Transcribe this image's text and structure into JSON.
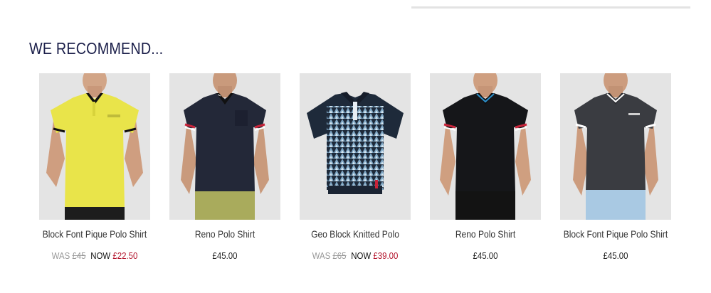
{
  "section": {
    "title": "WE RECOMMEND..."
  },
  "products": [
    {
      "name": "Block Font Pique Polo Shirt",
      "was_label": "WAS",
      "was_price": "£45",
      "now_label": "NOW",
      "now_price": "£22.50",
      "image": "yellow-polo-shirt-model",
      "shirt_color": "#e9e44a"
    },
    {
      "name": "Reno Polo Shirt",
      "price": "£45.00",
      "image": "navy-polo-shirt-model",
      "shirt_color": "#232838"
    },
    {
      "name": "Geo Block Knitted Polo",
      "was_label": "WAS",
      "was_price": "£65",
      "now_label": "NOW",
      "now_price": "£39.00",
      "image": "geo-knitted-polo-flat",
      "shirt_color": "#1e2a3a"
    },
    {
      "name": "Reno Polo Shirt",
      "price": "£45.00",
      "image": "black-polo-shirt-model",
      "shirt_color": "#151619"
    },
    {
      "name": "Block Font Pique Polo Shirt",
      "price": "£45.00",
      "image": "charcoal-polo-shirt-model",
      "shirt_color": "#3a3c41"
    }
  ]
}
